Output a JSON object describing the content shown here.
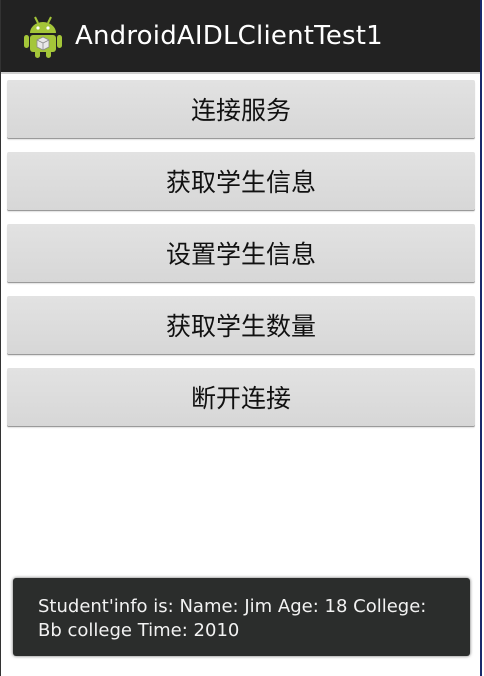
{
  "app": {
    "title": "AndroidAIDLClientTest1",
    "icon": "android-robot-icon",
    "icon_color": "#a4c639"
  },
  "buttons": [
    {
      "label": "连接服务"
    },
    {
      "label": "获取学生信息"
    },
    {
      "label": "设置学生信息"
    },
    {
      "label": "获取学生数量"
    },
    {
      "label": "断开连接"
    }
  ],
  "toast": {
    "text": "Student'info is: Name: Jim Age: 18 College: Bb college Time: 2010"
  },
  "colors": {
    "action_bar": "#222222",
    "button_bg": "#dadada",
    "toast_bg": "#2b2d2c"
  }
}
